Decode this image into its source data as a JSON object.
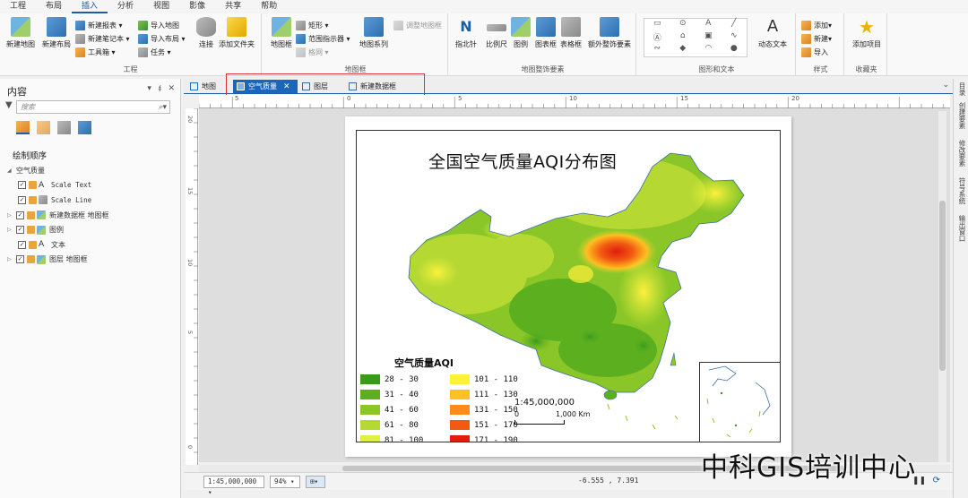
{
  "menu": [
    "工程",
    "布局",
    "插入",
    "分析",
    "视图",
    "影像",
    "共享",
    "帮助"
  ],
  "menu_active": "插入",
  "ribbon": {
    "project": {
      "title": "工程",
      "new_map": "新建地图",
      "new_layout": "新建布局",
      "new_report": "新建报表",
      "new_notebook": "新建笔记本",
      "toolbox": "工具箱",
      "import_map": "导入地图",
      "import_layout": "导入布局",
      "task": "任务",
      "connect": "连接",
      "add_folder": "添加文件夹"
    },
    "map_frame": {
      "title": "地图框",
      "map_frame": "地图框",
      "rectangle": "矩形",
      "extent_indicator": "范围指示器",
      "grid": "格网",
      "map_series": "地图系列",
      "reshape": "调整地图框"
    },
    "surround": {
      "title": "地图整饰要素",
      "north_arrow": "指北针",
      "scale_bar": "比例尺",
      "legend": "图例",
      "chart_frame": "图表框",
      "table_frame": "表格框",
      "extra": "额外整饰要素"
    },
    "graphics": {
      "title": "图形和文本",
      "dynamic_text": "动态文本"
    },
    "styles": {
      "title": "样式",
      "add": "添加",
      "new": "新建",
      "import": "导入"
    },
    "favorites": {
      "title": "收藏夹",
      "add_item": "添加项目"
    }
  },
  "contents": {
    "title": "内容",
    "controls": [
      "▾",
      "ᵮ",
      "✕"
    ],
    "search_placeholder": "搜索",
    "drawing_order": "绘制顺序",
    "layout_name": "空气质量",
    "items": [
      {
        "label": "Scale Text",
        "mono": true
      },
      {
        "label": "Scale Line",
        "mono": true
      },
      {
        "label": "新建数据框  地图框",
        "mono": false
      },
      {
        "label": "图例",
        "mono": false
      },
      {
        "label": "文本",
        "mono": false
      },
      {
        "label": "图层  地图框",
        "mono": false
      }
    ]
  },
  "tabs": [
    {
      "label": "地图",
      "active": false
    },
    {
      "label": "空气质量",
      "active": true
    },
    {
      "label": "图层",
      "active": false
    },
    {
      "label": "新建数据框",
      "active": false
    }
  ],
  "ruler_labels": [
    "5",
    "0",
    "5",
    "10",
    "15",
    "20"
  ],
  "vruler_labels": [
    "20",
    "15",
    "10",
    "5",
    "0"
  ],
  "layout": {
    "title": "全国空气质量AQI分布图",
    "legend_title": "空气质量AQI",
    "legend": [
      {
        "range": "28 - 30",
        "color": "#3a9a1c"
      },
      {
        "range": "31 - 40",
        "color": "#5cb020"
      },
      {
        "range": "41 - 60",
        "color": "#8ac628"
      },
      {
        "range": "61 - 80",
        "color": "#b5d832"
      },
      {
        "range": "81 - 100",
        "color": "#dff040"
      },
      {
        "range": "101 - 110",
        "color": "#fff03a"
      },
      {
        "range": "111 - 130",
        "color": "#ffc020"
      },
      {
        "range": "131 - 150",
        "color": "#ff8c1a"
      },
      {
        "range": "151 - 170",
        "color": "#f25a12"
      },
      {
        "range": "171 - 190",
        "color": "#e01e0e"
      }
    ],
    "scale_text": "1:45,000,000",
    "scale_left": "0",
    "scale_right": "1,000 Km"
  },
  "status": {
    "scale": "1:45,000,000",
    "zoom": "94%",
    "coords": "-6.555 , 7.391"
  },
  "right_tabs": [
    "目录",
    "创建要素",
    "修改要素",
    "符号系统",
    "输出窗口"
  ],
  "watermark": "中科GIS培训中心"
}
